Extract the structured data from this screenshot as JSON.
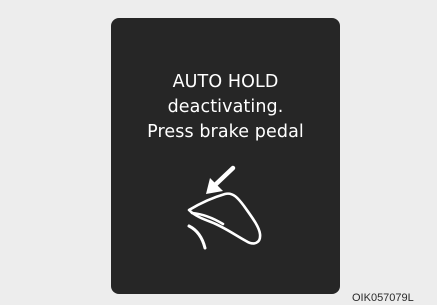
{
  "display": {
    "line1": "AUTO HOLD",
    "line2": "deactivating.",
    "line3": "Press brake pedal",
    "icon": "brake-pedal-press-icon"
  },
  "image_code": "OIK057079L",
  "colors": {
    "page_background": "#ededed",
    "display_background": "#262626",
    "display_text": "#ffffff"
  }
}
